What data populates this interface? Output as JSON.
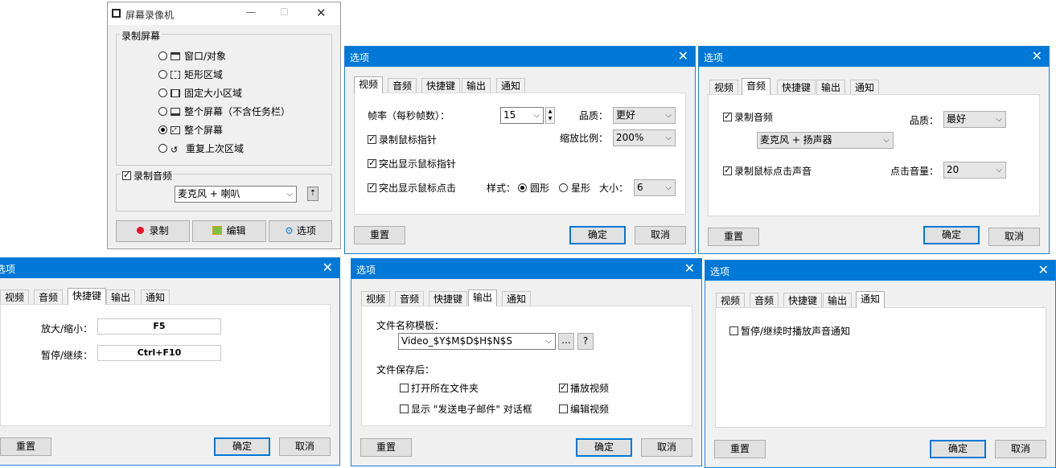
{
  "recorder": {
    "title": "屏幕录像机",
    "minimize": "—",
    "maximize": "☐",
    "close": "✕",
    "group_title": "录制屏幕",
    "modes": [
      "窗口/对象",
      "矩形区域",
      "固定大小区域",
      "整个屏幕（不含任务栏）",
      "整个屏幕",
      "重复上次区域"
    ],
    "selected_mode": 4,
    "audio_label": "录制音频",
    "audio_device": "麦克风 + 喇叭",
    "record_button": "录制",
    "edit_button": "编辑",
    "options_button": "选项",
    "colors": {
      "record": "#e81123",
      "accent": "#0078d7"
    }
  },
  "tabs": [
    "视频",
    "音频",
    "快捷键",
    "输出",
    "通知"
  ],
  "common": {
    "title": "选项",
    "reset": "重置",
    "ok": "确定",
    "cancel": "取消",
    "close": "✕"
  },
  "video": {
    "fps_label": "帧率（每秒帧数）：",
    "fps_value": "15",
    "quality_label": "品质：",
    "quality_value": "更好",
    "scale_label": "缩放比例：",
    "scale_value": "200%",
    "record_cursor": "录制鼠标指针",
    "highlight_cursor": "突出显示鼠标指针",
    "highlight_click": "突出显示鼠标点击",
    "style_label": "样式：",
    "style_circle": "圆形",
    "style_star": "星形",
    "size_label": "大小：",
    "size_value": "6"
  },
  "audio": {
    "record_audio": "录制音频",
    "quality_label": "品质：",
    "quality_value": "最好",
    "device": "麦克风 + 扬声器",
    "click_sound": "录制鼠标点击声音",
    "click_volume_label": "点击音量：",
    "click_volume_value": "20"
  },
  "hotkeys": {
    "zoom_label": "放大/缩小：",
    "zoom_value": "F5",
    "pause_label": "暂停/继续：",
    "pause_value": "Ctrl+F10"
  },
  "output": {
    "template_label": "文件名称模板：",
    "template_value": "Video_$Y$M$D$H$N$S",
    "browse": "...",
    "help": "?",
    "after_save_label": "文件保存后：",
    "open_folder": "打开所在文件夹",
    "play_video": "播放视频",
    "show_email": "显示 \"发送电子邮件\" 对话框",
    "edit_video": "编辑视频"
  },
  "notify": {
    "pause_sound": "暂停/继续时播放声音通知"
  }
}
